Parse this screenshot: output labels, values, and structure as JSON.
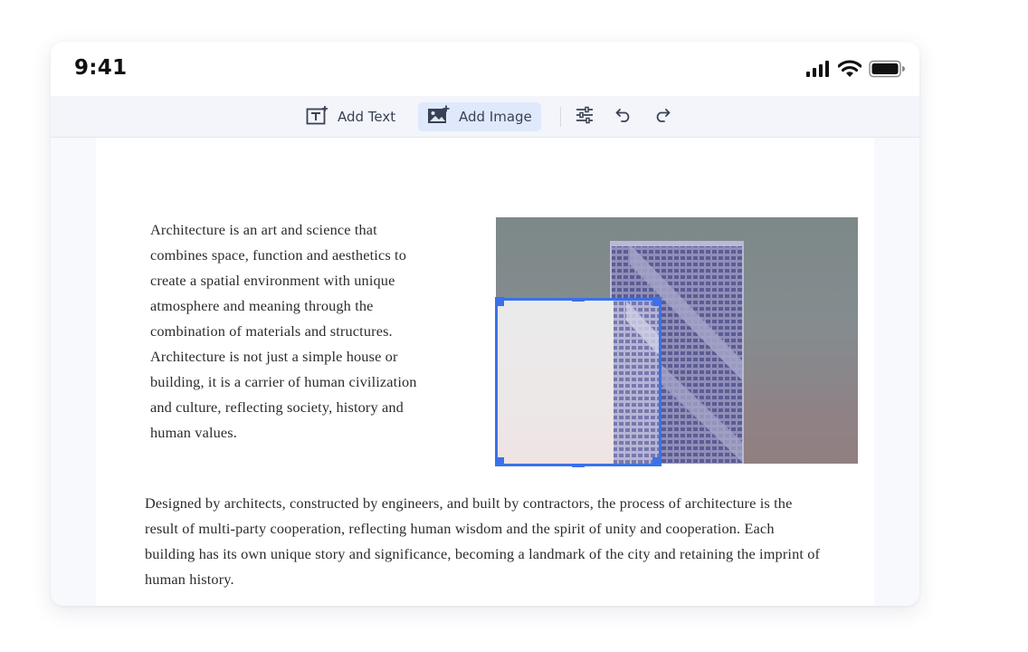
{
  "status_bar": {
    "time": "9:41",
    "icons": [
      "signal-icon",
      "wifi-icon",
      "battery-icon"
    ]
  },
  "toolbar": {
    "add_text_label": "Add Text",
    "add_image_label": "Add Image",
    "active_tool": "Add Image",
    "icons": [
      "add-text-icon",
      "add-image-icon",
      "adjust-icon",
      "undo-icon",
      "redo-icon"
    ],
    "accent_color": "#3a71ea",
    "active_background": "#dfe9fb"
  },
  "document": {
    "paragraph_1": "Architecture is an art and science that combines space, function and aesthetics to create a spatial environment with unique atmosphere and meaning through the combination of materials and structures. Architecture is not just a simple house or building, it is a carrier of human civilization and culture, reflecting society, history and human values.",
    "paragraph_2": "Designed by architects, constructed by engineers, and built by contractors, the process of architecture is the result of multi-party cooperation, reflecting human wisdom and the spirit of unity and cooperation. Each building has its own unique story and significance, becoming a landmark of the city and retaining the imprint of human history."
  },
  "image": {
    "subject": "high-rise building photo",
    "crop_selection_color": "#3a71ea"
  }
}
